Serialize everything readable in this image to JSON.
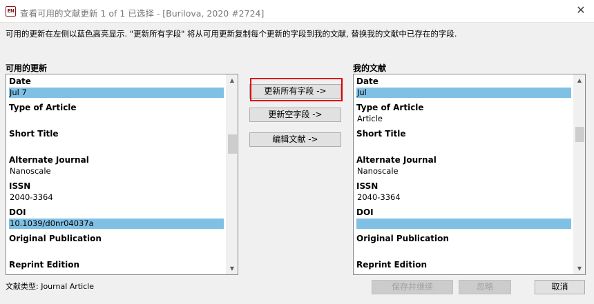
{
  "window": {
    "app_icon_text": "EN",
    "title": "查看可用的文献更新 1 of 1 已选择 - [Burilova, 2020 #2724]",
    "close_glyph": "✕"
  },
  "instruction": "可用的更新在左侧以蓝色高亮显示. \"更新所有字段\" 将从可用更新复制每个更新的字段到我的文献, 替换我的文献中已存在的字段.",
  "left_panel": {
    "label": "可用的更新",
    "fields": [
      {
        "name": "Date",
        "value": "Jul 7"
      },
      {
        "name": "Type of Article",
        "value": ""
      },
      {
        "name": "Short Title",
        "value": ""
      },
      {
        "name": "Alternate Journal",
        "value": "Nanoscale"
      },
      {
        "name": "ISSN",
        "value": "2040-3364"
      },
      {
        "name": "DOI",
        "value": "10.1039/d0nr04037a"
      },
      {
        "name": "Original Publication",
        "value": ""
      },
      {
        "name": "Reprint Edition",
        "value": ""
      }
    ]
  },
  "right_panel": {
    "label": "我的文献",
    "fields": [
      {
        "name": "Date",
        "value": "Jul"
      },
      {
        "name": "Type of Article",
        "value": "Article"
      },
      {
        "name": "Short Title",
        "value": ""
      },
      {
        "name": "Alternate Journal",
        "value": "Nanoscale"
      },
      {
        "name": "ISSN",
        "value": "2040-3364"
      },
      {
        "name": "DOI",
        "value": ""
      },
      {
        "name": "Original Publication",
        "value": ""
      },
      {
        "name": "Reprint Edition",
        "value": ""
      }
    ]
  },
  "middle_buttons": {
    "update_all": "更新所有字段 ->",
    "update_empty": "更新空字段 ->",
    "edit_reference": "编辑文献 ->"
  },
  "footer": {
    "reference_type": "文献类型: Journal Article",
    "save_continue": "保存并继续",
    "skip": "忽略",
    "cancel": "取消"
  },
  "icons": {
    "scroll_up": "▲",
    "scroll_down": "▼"
  },
  "colors": {
    "highlight": "#7fc0e4",
    "focus_box": "#e00000"
  }
}
